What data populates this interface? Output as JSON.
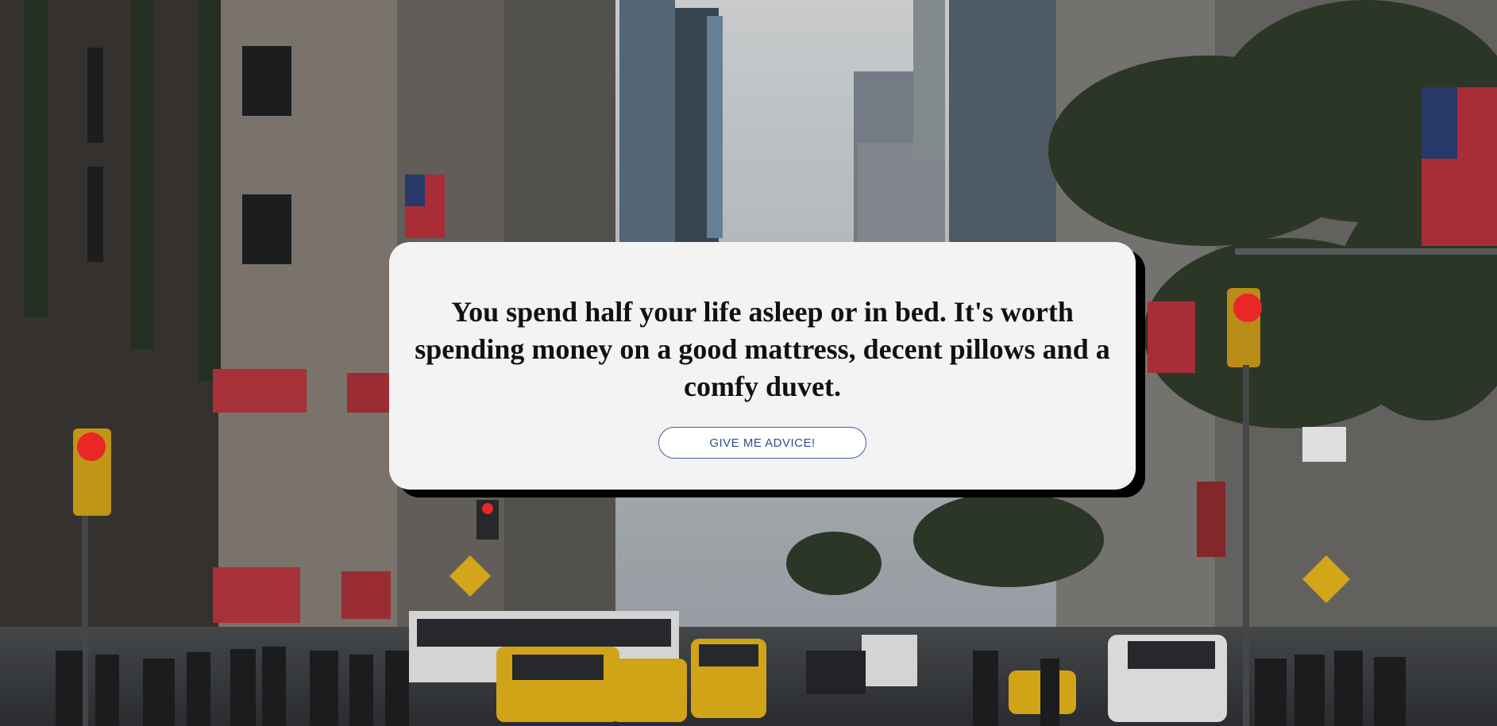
{
  "advice": {
    "text": "You spend half your life asleep or in bed. It's worth spending money on a good mattress, decent pillows and a comfy duvet.",
    "button_label": "GIVE ME ADVICE!"
  },
  "background": {
    "description_icon": "city-street-photo",
    "colors": {
      "sky": "#cfd3d6",
      "buildings": "#6e6f70",
      "taxi": "#e3b21a",
      "signal": "#ff2a2a",
      "trees": "#2f3b2a"
    }
  },
  "card": {
    "background": "#f3f3f4",
    "shadow": "#000000"
  },
  "button": {
    "border": "#3c5e9a",
    "text_color": "#2d4f8a"
  }
}
